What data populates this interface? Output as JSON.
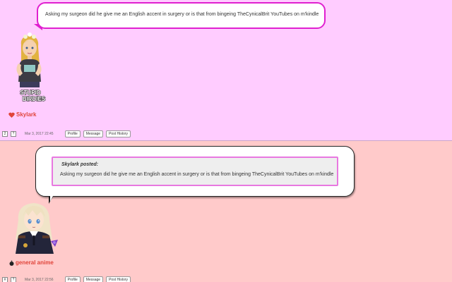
{
  "posts": [
    {
      "message": "Asking my surgeon did he give me an English accent in surgery or is that from bingeing TheCynicalBrit YouTubes on m'kindle",
      "username": "Skylark",
      "avatar_caption": [
        "STUPID",
        "BIRDIES"
      ],
      "date": "Mar 3, 2017 22:45",
      "square_labels": [
        "2",
        "?"
      ]
    },
    {
      "quote_header": "Skylark posted:",
      "quote_text": "Asking my surgeon did he give me an English accent in surgery or is that from bingeing TheCynicalBrit YouTubes on m'kindle",
      "username": "general anime",
      "date": "Mar 3, 2017 22:56",
      "square_labels": [
        "#",
        "?"
      ]
    }
  ],
  "buttons": {
    "profile": "Profile",
    "message": "Message",
    "history": "Post History"
  },
  "colors": {
    "post1_bg": "#ffccff",
    "post2_bg": "#ffcaca",
    "bubble_border": "#e020d0",
    "username": "#e0443a"
  }
}
